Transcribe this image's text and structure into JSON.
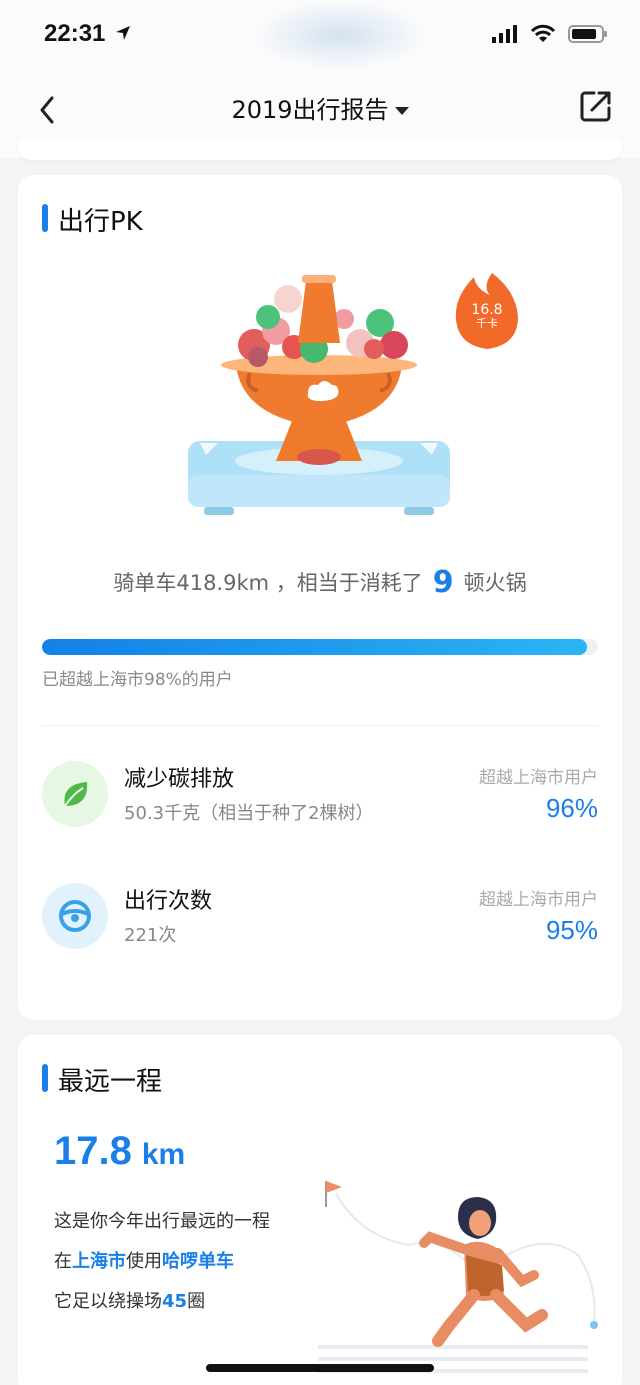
{
  "status_bar": {
    "time": "22:31"
  },
  "nav": {
    "title": "2019出行报告"
  },
  "pk_card": {
    "title": "出行PK",
    "flame_value": "16.8",
    "flame_unit": "千卡",
    "sentence_prefix": "骑单车418.9km ，相当于消耗了",
    "hotpot_count": "9",
    "sentence_suffix": "顿火锅",
    "progress_fraction": 0.98,
    "progress_caption": "已超越上海市98%的用户",
    "stats": [
      {
        "label": "减少碳排放",
        "sub": "50.3千克（相当于种了2棵树）",
        "compare_label": "超越上海市用户",
        "percent": "96%"
      },
      {
        "label": "出行次数",
        "sub": "221次",
        "compare_label": "超越上海市用户",
        "percent": "95%"
      }
    ]
  },
  "farthest_card": {
    "title": "最远一程",
    "distance_value": "17.8",
    "distance_unit": "km",
    "line1": "这是你今年出行最远的一程",
    "line2_prefix": "在",
    "line2_city": "上海市",
    "line2_mid": "使用",
    "line2_brand": "哈啰单车",
    "line3_prefix": "它足以绕操场",
    "line3_laps": "45",
    "line3_suffix": "圈"
  },
  "colors": {
    "accent": "#1a7fe8",
    "hotpot_orange": "#f07a2e",
    "flame": "#f26a2a"
  }
}
